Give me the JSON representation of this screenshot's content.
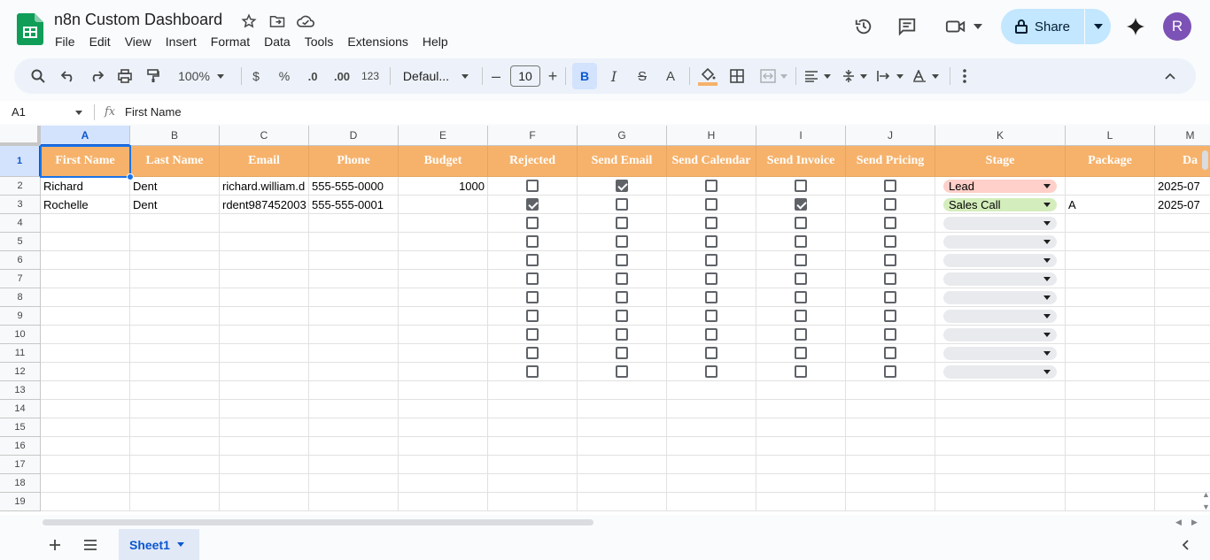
{
  "app": {
    "doc_title": "n8n Custom Dashboard",
    "menu": [
      "File",
      "Edit",
      "View",
      "Insert",
      "Format",
      "Data",
      "Tools",
      "Extensions",
      "Help"
    ],
    "share_label": "Share",
    "avatar_initial": "R",
    "brand_color": "#0f9d58",
    "accent_color": "#0b57d0"
  },
  "toolbar": {
    "zoom": "100%",
    "currency": "$",
    "percent": "%",
    "decrease_decimal": ".0",
    "increase_decimal": ".00",
    "number_format": "123",
    "font": "Defaul...",
    "font_size": "10",
    "bold": "B",
    "italic": "I",
    "strike": "S",
    "text_color": "A"
  },
  "formula_bar": {
    "name_box": "A1",
    "fx": "fx",
    "value": "First Name"
  },
  "grid": {
    "columns": [
      "A",
      "B",
      "C",
      "D",
      "E",
      "F",
      "G",
      "H",
      "I",
      "J",
      "K",
      "L",
      "M"
    ],
    "row_numbers": [
      "1",
      "2",
      "3",
      "4",
      "5",
      "6",
      "7",
      "8",
      "9",
      "10",
      "11",
      "12",
      "13",
      "14",
      "15",
      "16",
      "17",
      "18",
      "19"
    ],
    "header_color": "#f6b26b",
    "headers": [
      "First Name",
      "Last Name",
      "Email",
      "Phone",
      "Budget",
      "Rejected",
      "Send Email",
      "Send Calendar",
      "Send Invoice",
      "Send Pricing",
      "Stage",
      "Package",
      "Da"
    ],
    "rows": [
      {
        "first_name": "Richard",
        "last_name": "Dent",
        "email": "richard.william.d",
        "phone": "555-555-0000",
        "budget": "1000",
        "rejected": false,
        "send_email": true,
        "send_calendar": false,
        "send_invoice": false,
        "send_pricing": false,
        "stage": "Lead",
        "stage_color": "#ffcfc9",
        "package": "",
        "date": "2025-07"
      },
      {
        "first_name": "Rochelle",
        "last_name": "Dent",
        "email": "rdent987452003",
        "phone": "555-555-0001",
        "budget": "",
        "rejected": true,
        "send_email": false,
        "send_calendar": false,
        "send_invoice": true,
        "send_pricing": false,
        "stage": "Sales Call",
        "stage_color": "#d4edbc",
        "package": "A",
        "date": "2025-07"
      }
    ]
  },
  "sheets": {
    "active": "Sheet1"
  }
}
